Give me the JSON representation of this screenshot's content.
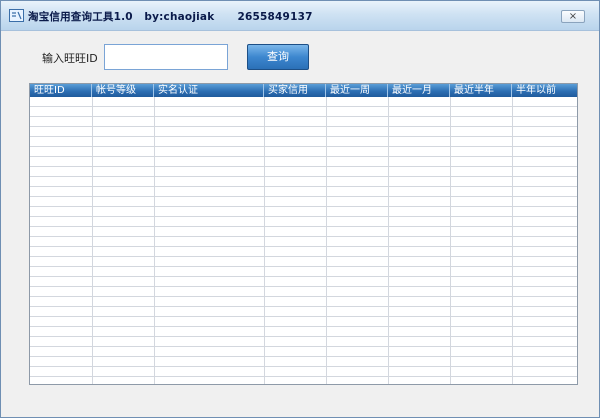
{
  "window": {
    "title": "淘宝信用查询工具1.0   by:chaojiak      2655849137",
    "close_symbol": "×"
  },
  "form": {
    "id_label": "输入旺旺ID",
    "id_value": "",
    "query_button": "查询"
  },
  "table": {
    "columns": [
      "旺旺ID",
      "帐号等级",
      "实名认证",
      "买家信用",
      "最近一周",
      "最近一月",
      "最近半年",
      "半年以前"
    ],
    "rows": []
  },
  "colors": {
    "title_bar": "#cfe2f3",
    "header": "#2d6fb4",
    "button": "#3d87cf"
  }
}
